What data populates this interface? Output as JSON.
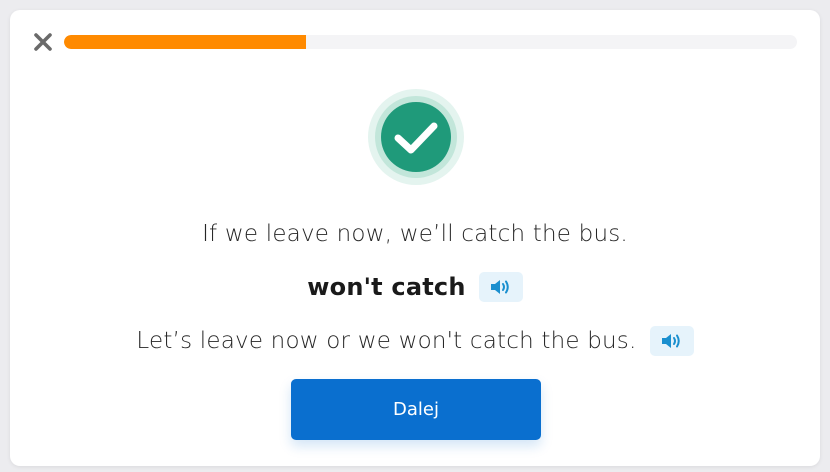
{
  "header": {
    "close_icon": "close-icon",
    "progress_fraction": 0.33,
    "progress_color": "#ff8a00"
  },
  "feedback": {
    "status_icon": "check-circle-icon",
    "status": "correct",
    "color": "#1f9a7a"
  },
  "exercise": {
    "prompt_sentence": "If we leave now, we’ll catch the bus.",
    "answer": "won't catch",
    "full_sentence": "Let’s leave now or we won't catch the bus."
  },
  "audio": {
    "icon": "speaker-icon",
    "icon_color": "#1a8fcf"
  },
  "actions": {
    "next_label": "Dalej",
    "next_color": "#0a6fcf"
  }
}
